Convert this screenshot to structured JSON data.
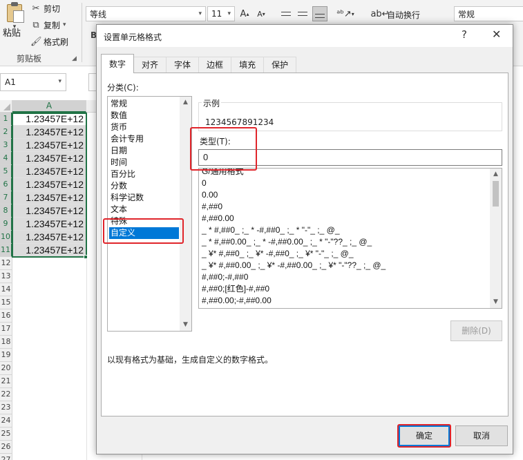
{
  "ribbon": {
    "paste_label": "粘贴",
    "cut_label": "剪切",
    "copy_label": "复制",
    "format_painter_label": "格式刷",
    "clipboard_group_label": "剪贴板",
    "font_name": "等线",
    "font_size": "11",
    "wrap_text_label": "自动换行",
    "number_format": "常规",
    "partial_letter": "B"
  },
  "formula_bar": {
    "name_box": "A1"
  },
  "sheet": {
    "column_header": "A",
    "rows": [
      {
        "num": "1",
        "value": "1.23457E+12"
      },
      {
        "num": "2",
        "value": "1.23457E+12"
      },
      {
        "num": "3",
        "value": "1.23457E+12"
      },
      {
        "num": "4",
        "value": "1.23457E+12"
      },
      {
        "num": "5",
        "value": "1.23457E+12"
      },
      {
        "num": "6",
        "value": "1.23457E+12"
      },
      {
        "num": "7",
        "value": "1.23457E+12"
      },
      {
        "num": "8",
        "value": "1.23457E+12"
      },
      {
        "num": "9",
        "value": "1.23457E+12"
      },
      {
        "num": "10",
        "value": "1.23457E+12"
      },
      {
        "num": "11",
        "value": "1.23457E+12"
      }
    ],
    "empty_rows": [
      "12",
      "13",
      "14",
      "15",
      "16",
      "17",
      "18",
      "19",
      "20",
      "21",
      "22",
      "23",
      "24",
      "25",
      "26",
      "27"
    ]
  },
  "dialog": {
    "title": "设置单元格格式",
    "help": "?",
    "close": "✕",
    "tabs": [
      "数字",
      "对齐",
      "字体",
      "边框",
      "填充",
      "保护"
    ],
    "active_tab": "数字",
    "category_label": "分类(C):",
    "categories": [
      "常规",
      "数值",
      "货币",
      "会计专用",
      "日期",
      "时间",
      "百分比",
      "分数",
      "科学记数",
      "文本",
      "特殊",
      "自定义"
    ],
    "selected_category": "自定义",
    "sample_label": "示例",
    "sample_value": "1234567891234",
    "type_label": "类型(T):",
    "type_value": "0",
    "formats": [
      "G/通用格式",
      "0",
      "0.00",
      "#,##0",
      "#,##0.00",
      "_ * #,##0_ ;_ * -#,##0_ ;_ * \"-\"_ ;_ @_",
      "_ * #,##0.00_ ;_ * -#,##0.00_ ;_ * \"-\"??_ ;_ @_",
      "_ ¥* #,##0_ ;_ ¥* -#,##0_ ;_ ¥* \"-\"_ ;_ @_",
      "_ ¥* #,##0.00_ ;_ ¥* -#,##0.00_ ;_ ¥* \"-\"??_ ;_ @_",
      "#,##0;-#,##0",
      "#,##0;[红色]-#,##0",
      "#,##0.00;-#,##0.00"
    ],
    "delete_label": "删除(D)",
    "description": "以现有格式为基础，生成自定义的数字格式。",
    "ok_label": "确定",
    "cancel_label": "取消"
  },
  "colors": {
    "excel_green": "#217346",
    "selection_blue": "#0078d7",
    "highlight_red": "#e0242a"
  }
}
